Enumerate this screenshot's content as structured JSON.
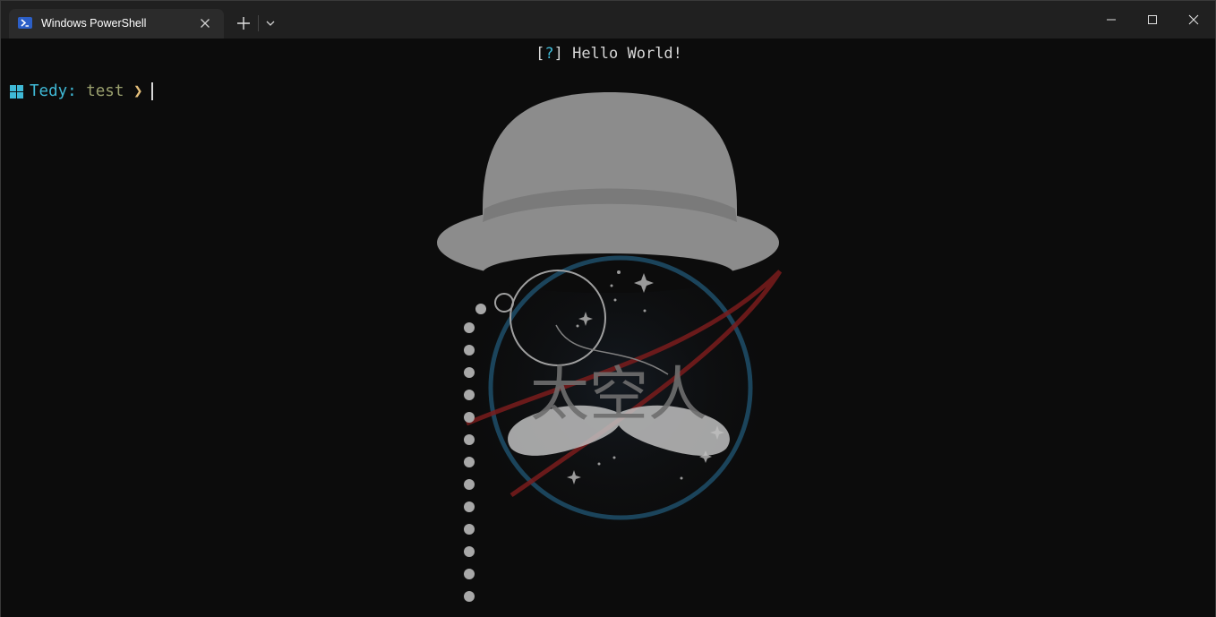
{
  "window": {
    "tab_title": "Windows PowerShell",
    "icons": {
      "tab": "powershell-icon",
      "close_tab": "close-icon",
      "new_tab": "plus-icon",
      "dropdown": "chevron-down-icon",
      "minimize": "minimize-icon",
      "maximize": "maximize-icon",
      "close": "close-icon"
    }
  },
  "terminal": {
    "hello": {
      "open_bracket": "[",
      "marker": "?",
      "close_bracket": "]",
      "message": " Hello World!"
    },
    "prompt": {
      "user": "Tedy:",
      "directory": "test",
      "arrow": "❯"
    },
    "background_image": {
      "text": "太空人"
    }
  },
  "colors": {
    "accent_cyan": "#3fb9d6",
    "directory": "#9aa06e",
    "arrow": "#e5c07b",
    "background": "#0c0c0c",
    "titlebar": "#202020"
  }
}
